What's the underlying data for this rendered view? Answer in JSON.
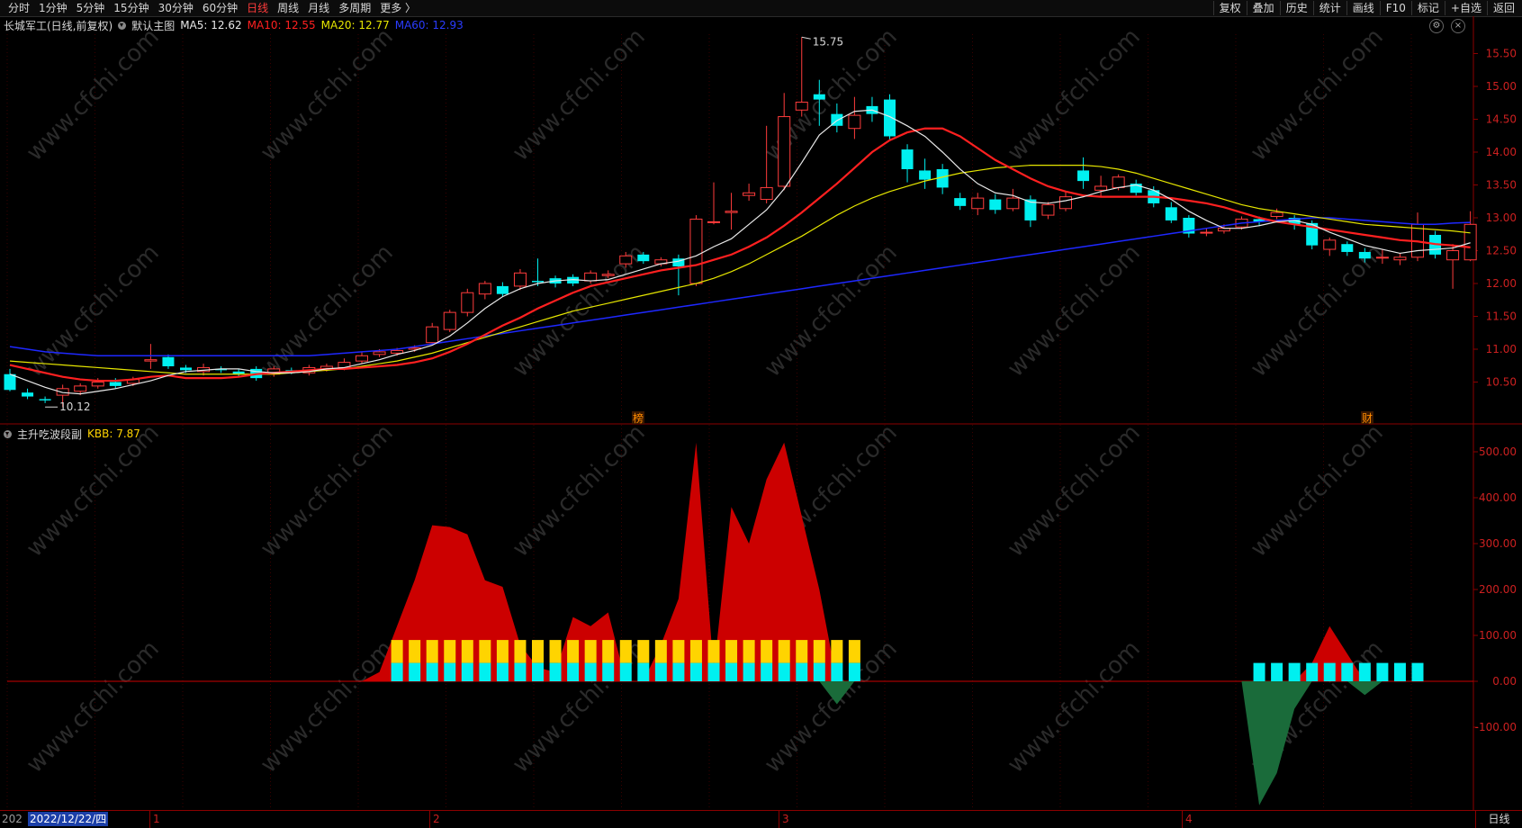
{
  "toolbar": {
    "periods": [
      "分时",
      "1分钟",
      "5分钟",
      "15分钟",
      "30分钟",
      "60分钟",
      "日线",
      "周线",
      "月线",
      "多周期",
      "更多 〉"
    ],
    "active_period": "日线",
    "right_items": [
      "复权",
      "叠加",
      "历史",
      "统计",
      "画线",
      "F10",
      "标记",
      "+自选",
      "返回"
    ]
  },
  "main_chart": {
    "stock_title": "长城军工(日线,前复权)",
    "indicator_name": "默认主图",
    "ma5": "MA5: 12.62",
    "ma10": "MA10: 12.55",
    "ma20": "MA20: 12.77",
    "ma60": "MA60: 12.93",
    "high_label": "15.75",
    "low_label": "10.12",
    "markers": [
      "榜",
      "财"
    ],
    "y_ticks": [
      "15.50",
      "15.00",
      "14.50",
      "14.00",
      "13.50",
      "13.00",
      "12.50",
      "12.00",
      "11.50",
      "11.00",
      "10.50"
    ]
  },
  "sub_chart": {
    "indicator_name": "主升吃波段副",
    "kbb": "KBB: 7.87",
    "y_ticks": [
      "500.00",
      "400.00",
      "300.00",
      "200.00",
      "100.00",
      "0.00",
      "-100.00"
    ]
  },
  "bottom": {
    "date_prefix": "202",
    "cursor_date": "2022/12/22/四",
    "month_marks": [
      "1",
      "2",
      "3",
      "4"
    ],
    "period_button": "日线"
  },
  "watermark_text": "www.cfchi.com",
  "colors": {
    "up": "#ff3c3c",
    "down": "#00f0f0",
    "ma5": "#e8e8e8",
    "ma10": "#ff2020",
    "ma20": "#e6e600",
    "ma60": "#1e28ff",
    "sub_red": "#cc0000",
    "sub_green": "#1a6b3a",
    "bar_yellow": "#ffd400",
    "bar_cyan": "#00f0f0"
  },
  "candles": [
    [
      10.62,
      10.38,
      10.7,
      10.36
    ],
    [
      10.34,
      10.28,
      10.4,
      10.24
    ],
    [
      10.24,
      10.22,
      10.28,
      10.18
    ],
    [
      10.3,
      10.4,
      10.46,
      10.12
    ],
    [
      10.36,
      10.44,
      10.48,
      10.3
    ],
    [
      10.44,
      10.5,
      10.56,
      10.4
    ],
    [
      10.5,
      10.44,
      10.56,
      10.4
    ],
    [
      10.48,
      10.54,
      10.58,
      10.44
    ],
    [
      10.82,
      10.84,
      11.08,
      10.7
    ],
    [
      10.88,
      10.74,
      10.92,
      10.7
    ],
    [
      10.72,
      10.68,
      10.76,
      10.64
    ],
    [
      10.66,
      10.72,
      10.78,
      10.6
    ],
    [
      10.7,
      10.68,
      10.74,
      10.64
    ],
    [
      10.66,
      10.62,
      10.7,
      10.58
    ],
    [
      10.7,
      10.56,
      10.74,
      10.52
    ],
    [
      10.62,
      10.7,
      10.74,
      10.58
    ],
    [
      10.68,
      10.66,
      10.72,
      10.62
    ],
    [
      10.64,
      10.72,
      10.76,
      10.6
    ],
    [
      10.7,
      10.74,
      10.78,
      10.66
    ],
    [
      10.72,
      10.8,
      10.86,
      10.68
    ],
    [
      10.82,
      10.9,
      10.96,
      10.78
    ],
    [
      10.92,
      10.96,
      11.0,
      10.88
    ],
    [
      10.94,
      10.98,
      11.02,
      10.9
    ],
    [
      11.0,
      11.02,
      11.06,
      10.96
    ],
    [
      11.1,
      11.34,
      11.4,
      11.06
    ],
    [
      11.3,
      11.56,
      11.6,
      11.26
    ],
    [
      11.56,
      11.86,
      11.92,
      11.5
    ],
    [
      11.84,
      12.0,
      12.04,
      11.76
    ],
    [
      11.96,
      11.84,
      12.02,
      11.8
    ],
    [
      11.96,
      12.16,
      12.22,
      11.9
    ],
    [
      12.04,
      12.02,
      12.38,
      11.96
    ],
    [
      12.08,
      12.0,
      12.12,
      11.94
    ],
    [
      12.1,
      12.0,
      12.14,
      11.96
    ],
    [
      12.04,
      12.16,
      12.2,
      12.0
    ],
    [
      12.12,
      12.14,
      12.2,
      12.08
    ],
    [
      12.3,
      12.42,
      12.48,
      12.24
    ],
    [
      12.44,
      12.34,
      12.48,
      12.3
    ],
    [
      12.3,
      12.36,
      12.4,
      12.26
    ],
    [
      12.38,
      12.26,
      12.44,
      11.82
    ],
    [
      12.0,
      12.98,
      13.04,
      11.96
    ],
    [
      12.94,
      12.94,
      13.54,
      12.9
    ],
    [
      13.08,
      13.1,
      13.38,
      12.82
    ],
    [
      13.34,
      13.38,
      13.52,
      13.26
    ],
    [
      13.28,
      13.46,
      14.4,
      13.22
    ],
    [
      13.48,
      14.54,
      14.9,
      13.42
    ],
    [
      14.64,
      14.76,
      15.75,
      14.54
    ],
    [
      14.88,
      14.8,
      15.1,
      14.4
    ],
    [
      14.58,
      14.4,
      14.74,
      14.3
    ],
    [
      14.36,
      14.56,
      14.84,
      14.2
    ],
    [
      14.7,
      14.58,
      14.84,
      14.46
    ],
    [
      14.8,
      14.24,
      14.88,
      14.18
    ],
    [
      14.04,
      13.74,
      14.12,
      13.54
    ],
    [
      13.72,
      13.58,
      13.9,
      13.44
    ],
    [
      13.74,
      13.46,
      13.82,
      13.36
    ],
    [
      13.3,
      13.18,
      13.38,
      13.12
    ],
    [
      13.14,
      13.3,
      13.38,
      13.04
    ],
    [
      13.28,
      13.12,
      13.36,
      13.06
    ],
    [
      13.14,
      13.3,
      13.44,
      13.1
    ],
    [
      13.28,
      12.96,
      13.34,
      12.86
    ],
    [
      13.04,
      13.2,
      13.24,
      12.98
    ],
    [
      13.14,
      13.32,
      13.4,
      13.1
    ],
    [
      13.72,
      13.56,
      13.92,
      13.44
    ],
    [
      13.42,
      13.48,
      13.64,
      13.32
    ],
    [
      13.46,
      13.62,
      13.66,
      13.42
    ],
    [
      13.52,
      13.38,
      13.58,
      13.34
    ],
    [
      13.42,
      13.22,
      13.48,
      13.16
    ],
    [
      13.16,
      12.96,
      13.24,
      12.92
    ],
    [
      13.0,
      12.76,
      13.04,
      12.7
    ],
    [
      12.78,
      12.78,
      12.84,
      12.72
    ],
    [
      12.8,
      12.84,
      12.9,
      12.76
    ],
    [
      12.86,
      12.98,
      13.02,
      12.82
    ],
    [
      12.98,
      12.94,
      13.02,
      12.88
    ],
    [
      13.02,
      13.08,
      13.14,
      12.98
    ],
    [
      13.0,
      12.9,
      13.04,
      12.82
    ],
    [
      12.92,
      12.58,
      12.96,
      12.52
    ],
    [
      12.52,
      12.66,
      12.7,
      12.42
    ],
    [
      12.6,
      12.48,
      12.64,
      12.42
    ],
    [
      12.48,
      12.38,
      12.54,
      12.32
    ],
    [
      12.4,
      12.4,
      12.52,
      12.3
    ],
    [
      12.36,
      12.4,
      12.46,
      12.28
    ],
    [
      12.4,
      12.9,
      13.08,
      12.34
    ],
    [
      12.74,
      12.44,
      12.8,
      12.38
    ],
    [
      12.36,
      12.5,
      12.6,
      11.92
    ],
    [
      12.36,
      12.9,
      13.1,
      12.34
    ]
  ],
  "ma5_values": [
    10.62,
    10.52,
    10.42,
    10.34,
    10.32,
    10.36,
    10.4,
    10.46,
    10.52,
    10.6,
    10.66,
    10.68,
    10.7,
    10.7,
    10.66,
    10.64,
    10.64,
    10.66,
    10.7,
    10.72,
    10.78,
    10.84,
    10.92,
    10.98,
    11.06,
    11.2,
    11.4,
    11.62,
    11.8,
    11.92,
    12.0,
    12.04,
    12.06,
    12.04,
    12.06,
    12.14,
    12.22,
    12.3,
    12.34,
    12.42,
    12.56,
    12.68,
    12.9,
    13.12,
    13.44,
    13.84,
    14.26,
    14.48,
    14.62,
    14.64,
    14.54,
    14.4,
    14.24,
    14.0,
    13.74,
    13.52,
    13.38,
    13.34,
    13.24,
    13.22,
    13.26,
    13.32,
    13.4,
    13.46,
    13.5,
    13.42,
    13.28,
    13.1,
    12.96,
    12.84,
    12.84,
    12.88,
    12.94,
    12.96,
    12.9,
    12.78,
    12.68,
    12.58,
    12.52,
    12.46,
    12.5,
    12.52,
    12.54,
    12.62
  ],
  "ma10_values": [
    10.76,
    10.7,
    10.64,
    10.58,
    10.54,
    10.52,
    10.52,
    10.54,
    10.58,
    10.6,
    10.56,
    10.56,
    10.56,
    10.58,
    10.62,
    10.64,
    10.66,
    10.68,
    10.7,
    10.7,
    10.72,
    10.74,
    10.76,
    10.8,
    10.86,
    10.96,
    11.08,
    11.22,
    11.36,
    11.48,
    11.62,
    11.74,
    11.86,
    11.96,
    12.02,
    12.08,
    12.14,
    12.2,
    12.24,
    12.28,
    12.36,
    12.44,
    12.56,
    12.7,
    12.88,
    13.08,
    13.3,
    13.52,
    13.76,
    14.0,
    14.18,
    14.3,
    14.36,
    14.36,
    14.24,
    14.06,
    13.88,
    13.74,
    13.6,
    13.48,
    13.4,
    13.34,
    13.32,
    13.32,
    13.32,
    13.32,
    13.3,
    13.26,
    13.22,
    13.16,
    13.08,
    13.0,
    12.94,
    12.9,
    12.86,
    12.82,
    12.78,
    12.74,
    12.7,
    12.66,
    12.64,
    12.6,
    12.58,
    12.55
  ],
  "ma20_values": [
    10.82,
    10.8,
    10.78,
    10.76,
    10.74,
    10.72,
    10.7,
    10.68,
    10.66,
    10.64,
    10.62,
    10.62,
    10.62,
    10.62,
    10.62,
    10.62,
    10.64,
    10.66,
    10.68,
    10.7,
    10.74,
    10.78,
    10.82,
    10.88,
    10.94,
    11.02,
    11.1,
    11.18,
    11.26,
    11.34,
    11.42,
    11.5,
    11.58,
    11.64,
    11.7,
    11.76,
    11.82,
    11.88,
    11.94,
    12.0,
    12.08,
    12.18,
    12.3,
    12.44,
    12.58,
    12.72,
    12.88,
    13.04,
    13.18,
    13.3,
    13.4,
    13.48,
    13.56,
    13.62,
    13.68,
    13.72,
    13.76,
    13.78,
    13.8,
    13.8,
    13.8,
    13.8,
    13.78,
    13.74,
    13.68,
    13.6,
    13.52,
    13.44,
    13.36,
    13.28,
    13.2,
    13.14,
    13.1,
    13.06,
    13.02,
    12.98,
    12.94,
    12.9,
    12.88,
    12.86,
    12.84,
    12.82,
    12.8,
    12.77
  ],
  "ma60_values": [
    11.04,
    11.0,
    10.96,
    10.94,
    10.92,
    10.9,
    10.9,
    10.9,
    10.9,
    10.9,
    10.9,
    10.9,
    10.9,
    10.9,
    10.9,
    10.9,
    10.9,
    10.9,
    10.92,
    10.94,
    10.96,
    10.98,
    11.0,
    11.04,
    11.08,
    11.12,
    11.16,
    11.2,
    11.24,
    11.28,
    11.32,
    11.36,
    11.4,
    11.44,
    11.48,
    11.52,
    11.56,
    11.6,
    11.64,
    11.68,
    11.72,
    11.76,
    11.8,
    11.84,
    11.88,
    11.92,
    11.96,
    12.0,
    12.04,
    12.08,
    12.12,
    12.16,
    12.2,
    12.24,
    12.28,
    12.32,
    12.36,
    12.4,
    12.44,
    12.48,
    12.52,
    12.56,
    12.6,
    12.64,
    12.68,
    12.72,
    12.76,
    12.8,
    12.84,
    12.88,
    12.92,
    12.94,
    12.96,
    12.98,
    13.0,
    13.0,
    12.98,
    12.96,
    12.94,
    12.92,
    12.9,
    12.9,
    12.92,
    12.93
  ],
  "sub_values": [
    0,
    0,
    0,
    0,
    0,
    0,
    0,
    0,
    0,
    0,
    0,
    0,
    0,
    0,
    0,
    0,
    0,
    0,
    0,
    0,
    0,
    20,
    120,
    220,
    340,
    336,
    320,
    220,
    206,
    80,
    30,
    20,
    140,
    120,
    150,
    0,
    0,
    80,
    180,
    520,
    20,
    380,
    300,
    440,
    520,
    360,
    200,
    -50,
    0,
    0,
    0,
    0,
    0,
    0,
    0,
    0,
    0,
    0,
    0,
    0,
    0,
    0,
    0,
    0,
    0,
    0,
    0,
    0,
    0,
    0,
    0,
    -270,
    -200,
    -60,
    40,
    120,
    60,
    -30,
    0,
    0,
    0,
    0,
    0,
    0
  ],
  "signal_bars": [
    22,
    23,
    24,
    25,
    26,
    27,
    28,
    29,
    30,
    31,
    32,
    33,
    34,
    35,
    36,
    37,
    38,
    39,
    40,
    41,
    42,
    43,
    44,
    45,
    46,
    47,
    48
  ],
  "cyan_only_bars": [
    71,
    72,
    73,
    74,
    75,
    76,
    77,
    78,
    79,
    80
  ]
}
